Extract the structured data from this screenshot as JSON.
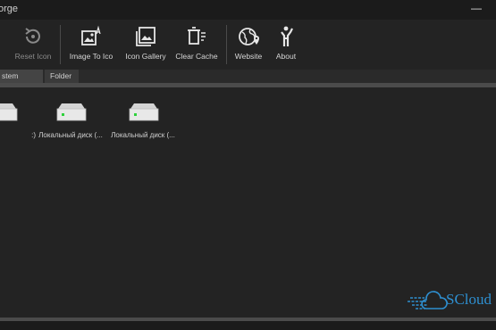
{
  "window": {
    "title": "orge",
    "minimize_glyph": "—"
  },
  "toolbar": {
    "partial_label": "",
    "reset_icon_label": "Reset Icon",
    "image_to_ico_label": "Image To Ico",
    "icon_gallery_label": "Icon Gallery",
    "clear_cache_label": "Clear Cache",
    "website_label": "Website",
    "about_label": "About"
  },
  "tabs": [
    {
      "label": "stem Icons"
    },
    {
      "label": "Folder"
    }
  ],
  "drives": [
    {
      "label": ":)",
      "icon": "hard-drive-icon"
    },
    {
      "label": "Локальный диск (...",
      "icon": "hard-drive-icon"
    },
    {
      "label": "Локальный диск (...",
      "icon": "hard-drive-icon"
    }
  ],
  "watermark": {
    "text": "SCloud"
  },
  "colors": {
    "accent": "#2e8fd0",
    "drive_led": "#2fd23c"
  }
}
